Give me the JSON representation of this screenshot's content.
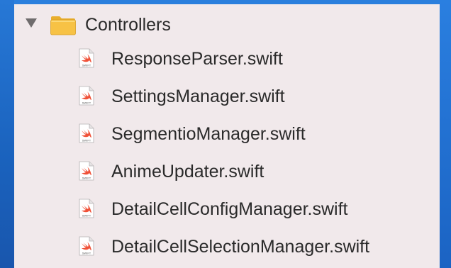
{
  "navigator": {
    "folder": {
      "name": "Controllers",
      "expanded": true,
      "icon": "folder-icon",
      "color": "#f7c245"
    },
    "files": [
      {
        "name": "ResponseParser.swift",
        "icon": "swift-file-icon"
      },
      {
        "name": "SettingsManager.swift",
        "icon": "swift-file-icon"
      },
      {
        "name": "SegmentioManager.swift",
        "icon": "swift-file-icon"
      },
      {
        "name": "AnimeUpdater.swift",
        "icon": "swift-file-icon"
      },
      {
        "name": "DetailCellConfigManager.swift",
        "icon": "swift-file-icon"
      },
      {
        "name": "DetailCellSelectionManager.swift",
        "icon": "swift-file-icon"
      }
    ],
    "file_icon_caption": "SWIFT",
    "colors": {
      "panel_background": "#f1e9eb",
      "desktop_background": "#1a66c4",
      "swift_orange": "#f05138"
    }
  }
}
